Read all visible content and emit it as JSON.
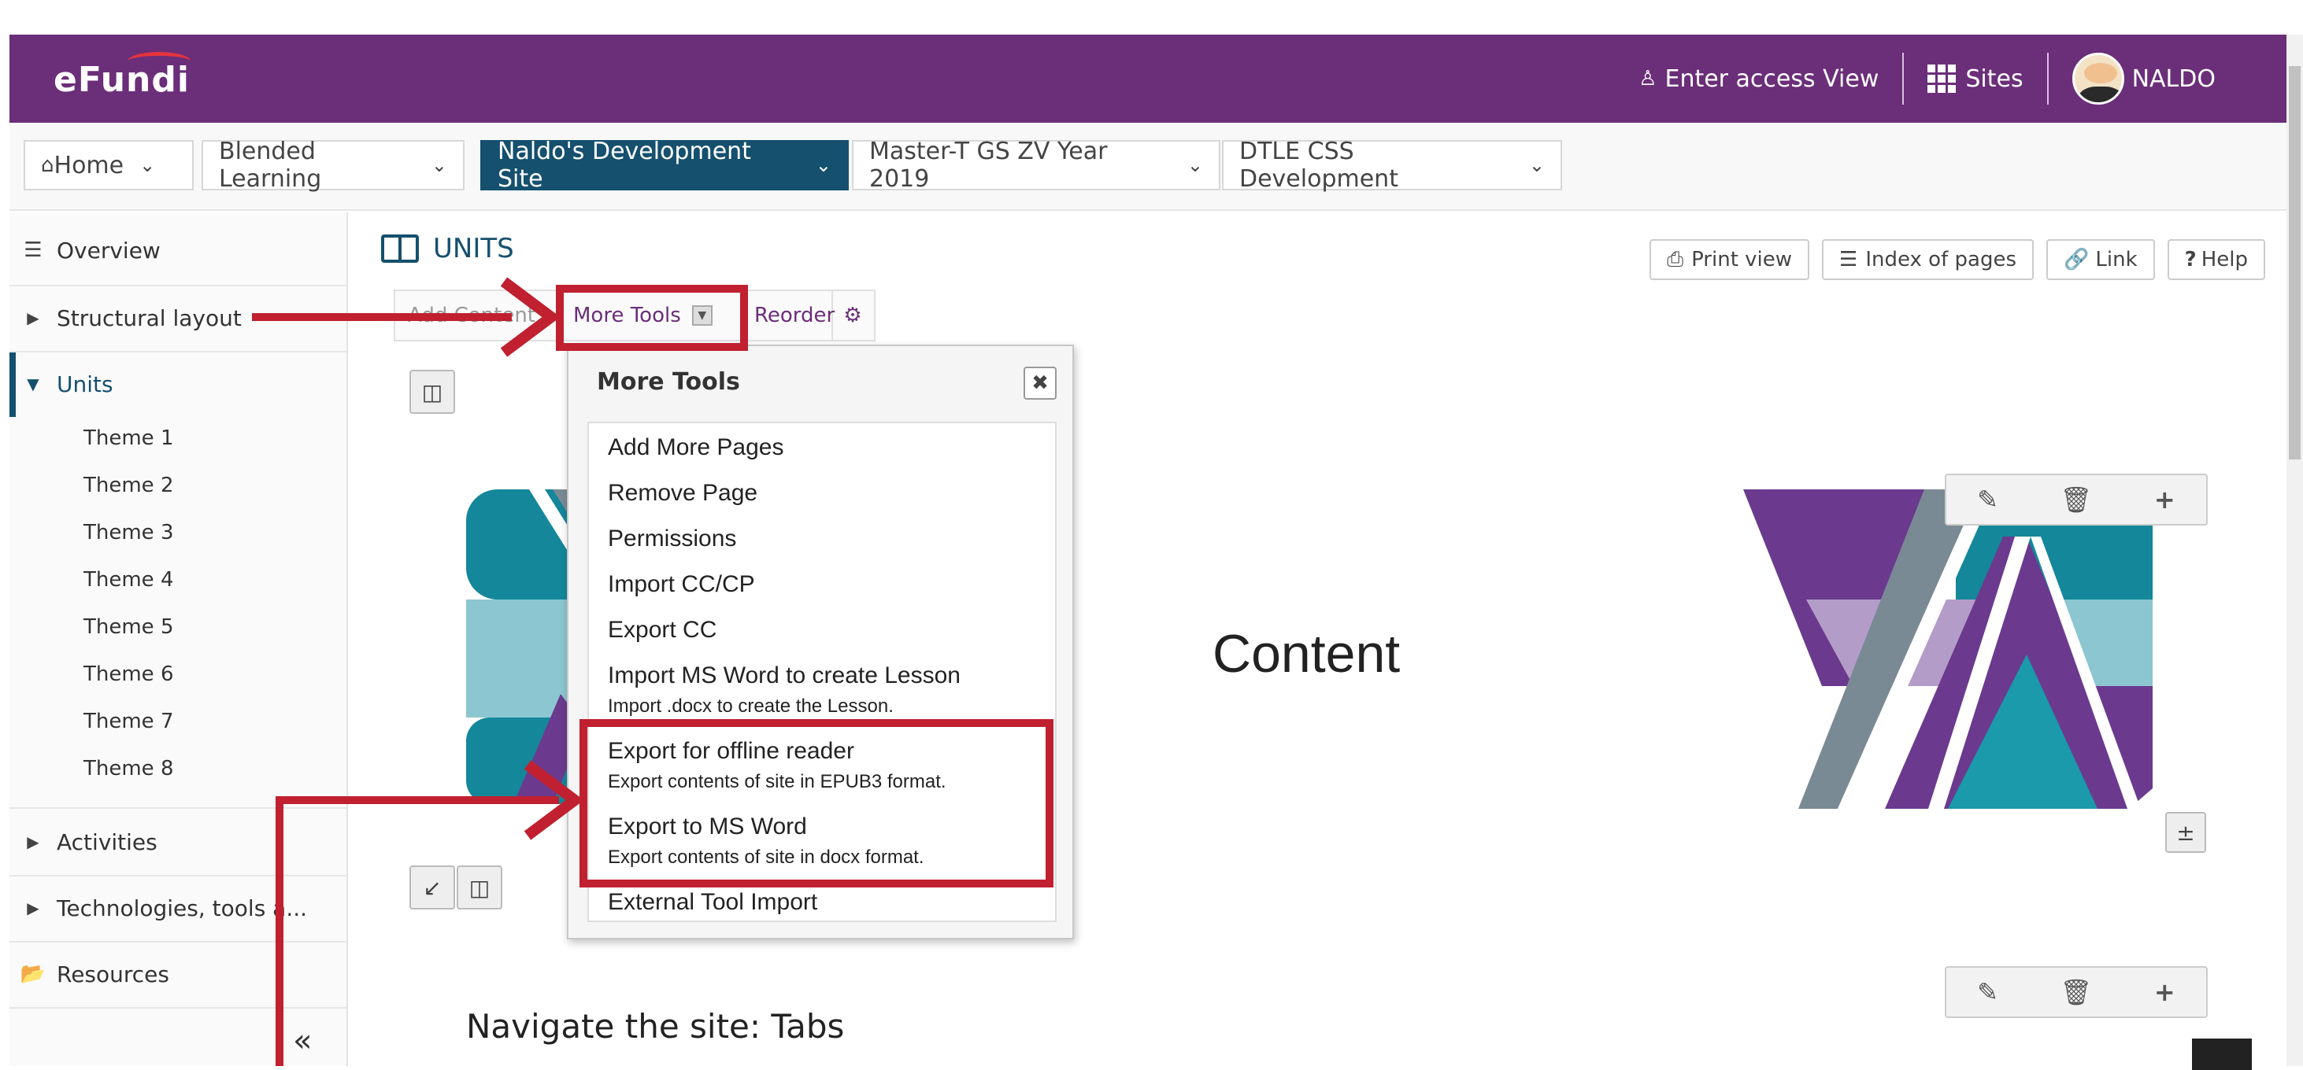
{
  "header": {
    "logo": "eFundi",
    "access_view": "Enter access View",
    "sites_label": "Sites",
    "user_name": "NALDO"
  },
  "site_tabs": [
    {
      "label": "Home"
    },
    {
      "label": "Blended Learning"
    },
    {
      "label": "Naldo's Development Site",
      "active": true
    },
    {
      "label": "Master-T GS ZV Year 2019"
    },
    {
      "label": "DTLE CSS Development"
    }
  ],
  "tool_menu": {
    "overview": "Overview",
    "structural": "Structural layout",
    "units": "Units",
    "themes": [
      "Theme 1",
      "Theme 2",
      "Theme 3",
      "Theme 4",
      "Theme 5",
      "Theme 6",
      "Theme 7",
      "Theme 8"
    ],
    "activities": "Activities",
    "technologies": "Technologies, tools a...",
    "resources": "Resources",
    "collapse": "«"
  },
  "main": {
    "title": "UNITS",
    "buttons": {
      "print": "Print view",
      "index": "Index of pages",
      "link": "Link",
      "help": "Help"
    },
    "toolbar": {
      "add": "Add Content",
      "more": "More Tools",
      "reorder": "Reorder"
    },
    "content_heading": "Content",
    "nav_heading": "Navigate the site: Tabs"
  },
  "more_tools": {
    "title": "More Tools",
    "items": [
      {
        "label": "Add More Pages"
      },
      {
        "label": "Remove Page"
      },
      {
        "label": "Permissions"
      },
      {
        "label": "Import CC/CP"
      },
      {
        "label": "Export CC"
      },
      {
        "label": "Import MS Word to create Lesson",
        "desc": "Import .docx to create the Lesson."
      },
      {
        "label": "Export for offline reader",
        "desc": "Export contents of site in EPUB3 format."
      },
      {
        "label": "Export to MS Word",
        "desc": "Export contents of site in docx format."
      },
      {
        "label": "External Tool Import"
      }
    ]
  },
  "colors": {
    "header": "#6b2e79",
    "active_tab": "#15506e",
    "annotation": "#c0202f",
    "logo_teal": "#14879a",
    "logo_purple": "#6b3a8e"
  }
}
